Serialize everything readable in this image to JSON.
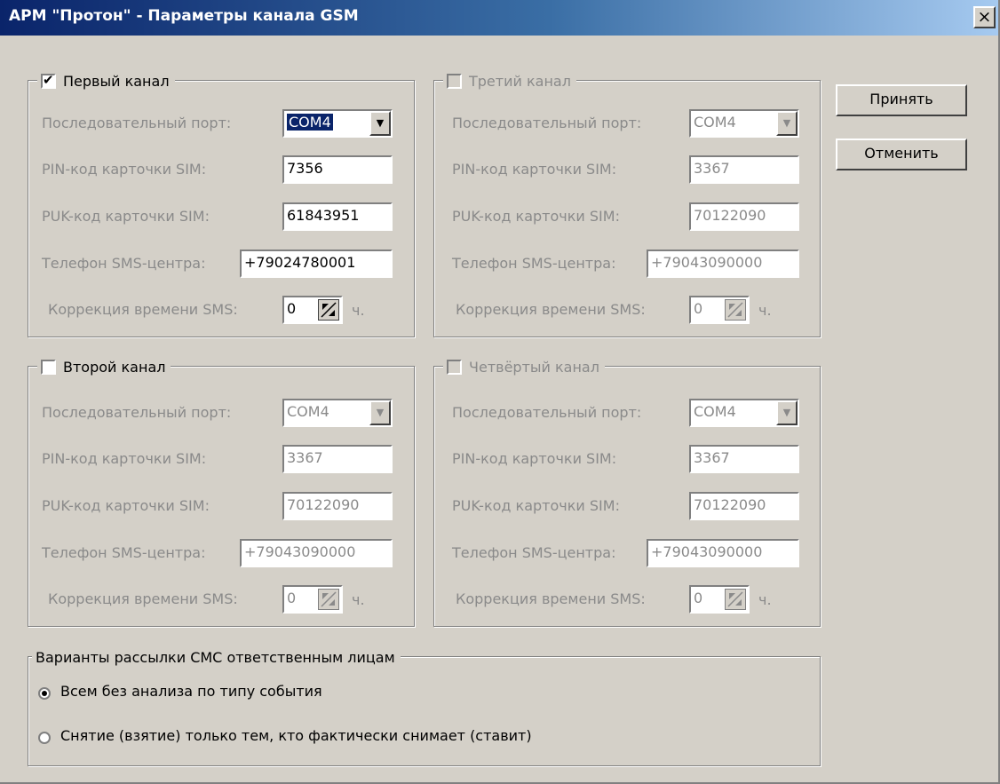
{
  "window": {
    "title": "АРМ \"Протон\" - Параметры канала GSM",
    "close_glyph": "×"
  },
  "channels": [
    {
      "title": "Первый канал",
      "checked": true,
      "port": "COM4",
      "pin": "7356",
      "puk": "61843951",
      "phone": "+79024780001",
      "correction": "0"
    },
    {
      "title": "Третий канал",
      "checked": false,
      "port": "COM4",
      "pin": "3367",
      "puk": "70122090",
      "phone": "+79043090000",
      "correction": "0"
    },
    {
      "title": "Второй канал",
      "checked": false,
      "port": "COM4",
      "pin": "3367",
      "puk": "70122090",
      "phone": "+79043090000",
      "correction": "0"
    },
    {
      "title": "Четвёртый канал",
      "checked": false,
      "port": "COM4",
      "pin": "3367",
      "puk": "70122090",
      "phone": "+79043090000",
      "correction": "0"
    }
  ],
  "labels": {
    "port": "Последовательный порт:",
    "pin": "PIN-код карточки SIM:",
    "puk": "PUK-код карточки SIM:",
    "phone": "Телефон SMS-центра:",
    "correction": "Коррекция времени SMS:",
    "unit": "ч."
  },
  "buttons": {
    "accept": "Принять",
    "cancel": "Отменить"
  },
  "sms_options": {
    "title": "Варианты рассылки СМС ответственным лицам",
    "options": [
      {
        "label": "Всем без анализа по типу события",
        "selected": true
      },
      {
        "label": "Снятие (взятие) только тем, кто фактически снимает (ставит)",
        "selected": false
      }
    ]
  },
  "icons": {
    "check": "checkmark-icon",
    "dropdown": "chevron-down-icon",
    "spin": "spin-arrows-icon",
    "close": "close-icon"
  }
}
